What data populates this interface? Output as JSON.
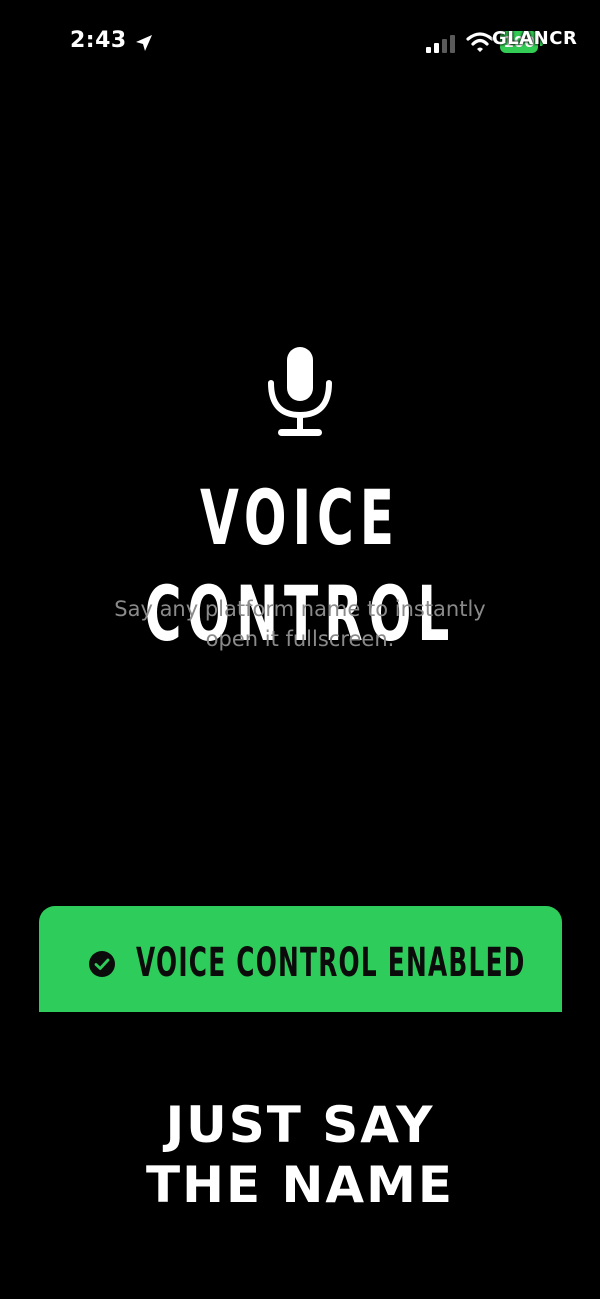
{
  "status_bar": {
    "time": "2:43",
    "location_icon": "location-arrow-icon",
    "signal_icon": "cellular-signal-icon",
    "wifi_icon": "wifi-icon",
    "battery_level": "100",
    "battery_color": "#33cc55"
  },
  "watermark": "GLANCR",
  "hero": {
    "icon": "microphone-icon",
    "title": "VOICE CONTROL",
    "subtitle_line1": "Say any platform name to instantly",
    "subtitle_line2": "open it fullscreen."
  },
  "banner": {
    "icon": "check-circle-icon",
    "label": "VOICE CONTROL ENABLED",
    "color": "#2ecc5a"
  },
  "caption": {
    "line1": "JUST SAY",
    "line2": "THE NAME"
  },
  "colors": {
    "background": "#000000",
    "subtitle": "#8a8a8a",
    "accent": "#2ecc5a"
  }
}
